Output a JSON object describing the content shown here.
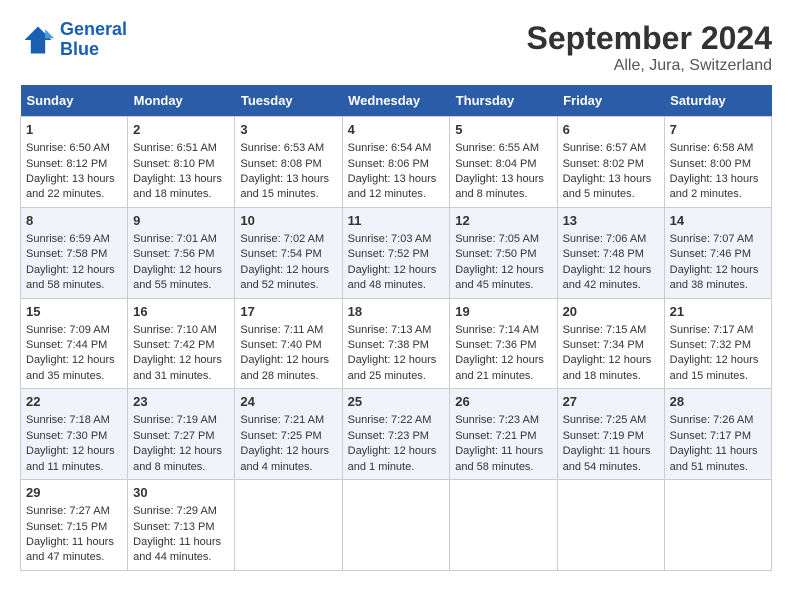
{
  "logo": {
    "line1": "General",
    "line2": "Blue"
  },
  "title": "September 2024",
  "subtitle": "Alle, Jura, Switzerland",
  "headers": [
    "Sunday",
    "Monday",
    "Tuesday",
    "Wednesday",
    "Thursday",
    "Friday",
    "Saturday"
  ],
  "weeks": [
    [
      {
        "day": "1",
        "sunrise": "6:50 AM",
        "sunset": "8:12 PM",
        "daylight": "13 hours and 22 minutes."
      },
      {
        "day": "2",
        "sunrise": "6:51 AM",
        "sunset": "8:10 PM",
        "daylight": "13 hours and 18 minutes."
      },
      {
        "day": "3",
        "sunrise": "6:53 AM",
        "sunset": "8:08 PM",
        "daylight": "13 hours and 15 minutes."
      },
      {
        "day": "4",
        "sunrise": "6:54 AM",
        "sunset": "8:06 PM",
        "daylight": "13 hours and 12 minutes."
      },
      {
        "day": "5",
        "sunrise": "6:55 AM",
        "sunset": "8:04 PM",
        "daylight": "13 hours and 8 minutes."
      },
      {
        "day": "6",
        "sunrise": "6:57 AM",
        "sunset": "8:02 PM",
        "daylight": "13 hours and 5 minutes."
      },
      {
        "day": "7",
        "sunrise": "6:58 AM",
        "sunset": "8:00 PM",
        "daylight": "13 hours and 2 minutes."
      }
    ],
    [
      {
        "day": "8",
        "sunrise": "6:59 AM",
        "sunset": "7:58 PM",
        "daylight": "12 hours and 58 minutes."
      },
      {
        "day": "9",
        "sunrise": "7:01 AM",
        "sunset": "7:56 PM",
        "daylight": "12 hours and 55 minutes."
      },
      {
        "day": "10",
        "sunrise": "7:02 AM",
        "sunset": "7:54 PM",
        "daylight": "12 hours and 52 minutes."
      },
      {
        "day": "11",
        "sunrise": "7:03 AM",
        "sunset": "7:52 PM",
        "daylight": "12 hours and 48 minutes."
      },
      {
        "day": "12",
        "sunrise": "7:05 AM",
        "sunset": "7:50 PM",
        "daylight": "12 hours and 45 minutes."
      },
      {
        "day": "13",
        "sunrise": "7:06 AM",
        "sunset": "7:48 PM",
        "daylight": "12 hours and 42 minutes."
      },
      {
        "day": "14",
        "sunrise": "7:07 AM",
        "sunset": "7:46 PM",
        "daylight": "12 hours and 38 minutes."
      }
    ],
    [
      {
        "day": "15",
        "sunrise": "7:09 AM",
        "sunset": "7:44 PM",
        "daylight": "12 hours and 35 minutes."
      },
      {
        "day": "16",
        "sunrise": "7:10 AM",
        "sunset": "7:42 PM",
        "daylight": "12 hours and 31 minutes."
      },
      {
        "day": "17",
        "sunrise": "7:11 AM",
        "sunset": "7:40 PM",
        "daylight": "12 hours and 28 minutes."
      },
      {
        "day": "18",
        "sunrise": "7:13 AM",
        "sunset": "7:38 PM",
        "daylight": "12 hours and 25 minutes."
      },
      {
        "day": "19",
        "sunrise": "7:14 AM",
        "sunset": "7:36 PM",
        "daylight": "12 hours and 21 minutes."
      },
      {
        "day": "20",
        "sunrise": "7:15 AM",
        "sunset": "7:34 PM",
        "daylight": "12 hours and 18 minutes."
      },
      {
        "day": "21",
        "sunrise": "7:17 AM",
        "sunset": "7:32 PM",
        "daylight": "12 hours and 15 minutes."
      }
    ],
    [
      {
        "day": "22",
        "sunrise": "7:18 AM",
        "sunset": "7:30 PM",
        "daylight": "12 hours and 11 minutes."
      },
      {
        "day": "23",
        "sunrise": "7:19 AM",
        "sunset": "7:27 PM",
        "daylight": "12 hours and 8 minutes."
      },
      {
        "day": "24",
        "sunrise": "7:21 AM",
        "sunset": "7:25 PM",
        "daylight": "12 hours and 4 minutes."
      },
      {
        "day": "25",
        "sunrise": "7:22 AM",
        "sunset": "7:23 PM",
        "daylight": "12 hours and 1 minute."
      },
      {
        "day": "26",
        "sunrise": "7:23 AM",
        "sunset": "7:21 PM",
        "daylight": "11 hours and 58 minutes."
      },
      {
        "day": "27",
        "sunrise": "7:25 AM",
        "sunset": "7:19 PM",
        "daylight": "11 hours and 54 minutes."
      },
      {
        "day": "28",
        "sunrise": "7:26 AM",
        "sunset": "7:17 PM",
        "daylight": "11 hours and 51 minutes."
      }
    ],
    [
      {
        "day": "29",
        "sunrise": "7:27 AM",
        "sunset": "7:15 PM",
        "daylight": "11 hours and 47 minutes."
      },
      {
        "day": "30",
        "sunrise": "7:29 AM",
        "sunset": "7:13 PM",
        "daylight": "11 hours and 44 minutes."
      },
      null,
      null,
      null,
      null,
      null
    ]
  ]
}
